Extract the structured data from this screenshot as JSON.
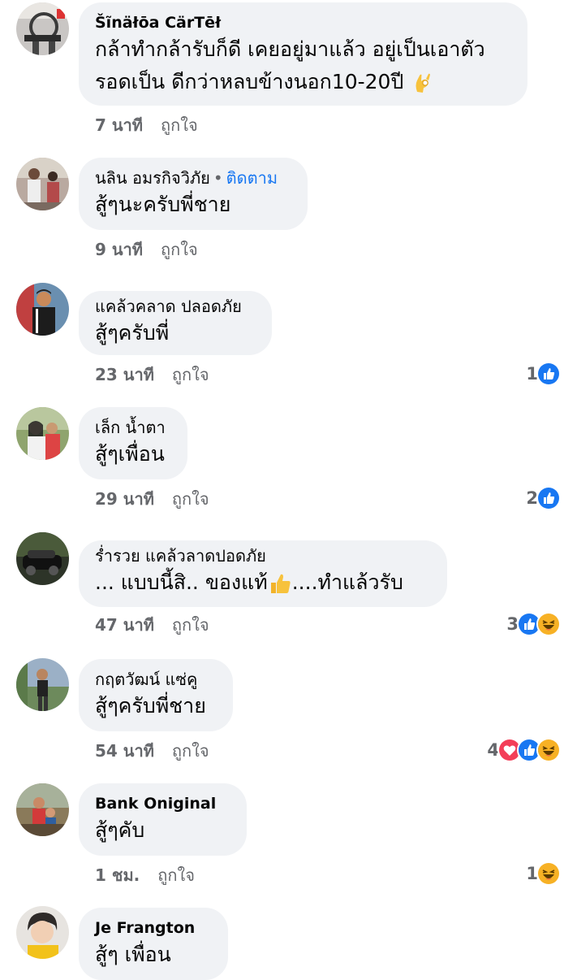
{
  "comments": [
    {
      "name": "Šĩnäłōa CärTēł",
      "name_style": "latin",
      "lines": [
        "กล้าทำกล้ารับก็ดี เคยอยู่มาแล้ว อยู่เป็นเอาตัว",
        "รอดเป็น ดีกว่าหลบข้างนอก10-20ปี"
      ],
      "emoji": "ok-hand-icon",
      "time": "7 นาที",
      "like_label": "ถูกใจ",
      "reactions": null
    },
    {
      "name": "นลิน อมรกิจวิภัย",
      "name_style": "thai",
      "follow": "ติดตาม",
      "follow_sep": "•",
      "lines": [
        "สู้ๆนะครับพี่ชาย"
      ],
      "time": "9 นาที",
      "like_label": "ถูกใจ",
      "reactions": null
    },
    {
      "name": "แคล้วคลาด ปลอดภัย",
      "name_style": "thai",
      "lines": [
        "สู้ๆครับพี่"
      ],
      "time": "23 นาที",
      "like_label": "ถูกใจ",
      "reactions": {
        "count": "1",
        "icons": [
          "like-reaction-icon"
        ]
      }
    },
    {
      "name": "เล็ก น้ำตา",
      "name_style": "thai",
      "lines": [
        "สู้ๆเพื่อน"
      ],
      "time": "29 นาที",
      "like_label": "ถูกใจ",
      "reactions": {
        "count": "2",
        "icons": [
          "like-reaction-icon"
        ]
      }
    },
    {
      "name": "ร่ำรวย แคล้วลาดปอดภัย",
      "name_style": "thai",
      "lines": [
        "... แบบนี้สิ.. ของแท้",
        "....ทำแล้วรับ"
      ],
      "emoji": "thumbs-up-icon",
      "time": "47 นาที",
      "like_label": "ถูกใจ",
      "reactions": {
        "count": "3",
        "icons": [
          "like-reaction-icon",
          "haha-reaction-icon"
        ]
      }
    },
    {
      "name": "กฤตวัฒน์ แซ่คู",
      "name_style": "thai",
      "lines": [
        "สู้ๆครับพี่ชาย"
      ],
      "time": "54 นาที",
      "like_label": "ถูกใจ",
      "reactions": {
        "count": "4",
        "icons": [
          "love-reaction-icon",
          "like-reaction-icon",
          "haha-reaction-icon"
        ]
      }
    },
    {
      "name": "Bank Oniginal",
      "name_style": "latin",
      "lines": [
        "สู้ๆคับ"
      ],
      "time": "1 ชม.",
      "like_label": "ถูกใจ",
      "reactions": {
        "count": "1",
        "icons": [
          "haha-reaction-icon"
        ]
      }
    },
    {
      "name": "Je Frangton",
      "name_style": "latin",
      "lines": [
        "สู้ๆ เพื่อน"
      ],
      "time": "",
      "like_label": "",
      "reactions": null
    }
  ],
  "colors": {
    "bubble": "#f0f2f5",
    "meta": "#65676b",
    "link": "#1877f2",
    "like": "#1877f2",
    "love": "#f33e58",
    "haha": "#f7b125"
  }
}
